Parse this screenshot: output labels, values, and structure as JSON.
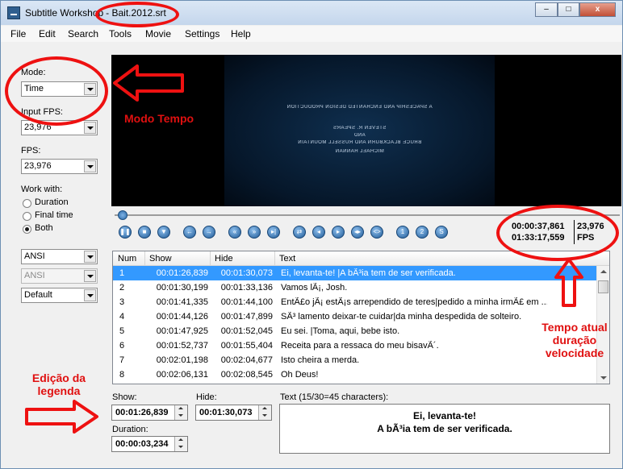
{
  "window": {
    "app_title": "Subtitle Workshop",
    "file_title": "- Bait.2012.srt",
    "minimize": "–",
    "maximize": "□",
    "close": "x"
  },
  "menu": [
    "File",
    "Edit",
    "Search",
    "Tools",
    "Movie",
    "Settings",
    "Help"
  ],
  "left_panel": {
    "mode_label": "Mode:",
    "mode_value": "Time",
    "input_fps_label": "Input FPS:",
    "input_fps_value": "23,976",
    "fps_label": "FPS:",
    "fps_value": "23,976",
    "work_with_label": "Work with:",
    "radios": [
      {
        "label": "Duration",
        "checked": false
      },
      {
        "label": "Final time",
        "checked": false
      },
      {
        "label": "Both",
        "checked": true
      }
    ],
    "charset1": "ANSI",
    "charset2": "ANSI",
    "format": "Default"
  },
  "video": {
    "credit_line1": "A SPACESHIP AND ENCHANTED DESIGN PRODUCTION",
    "credit_line2": "STEVEN R. SPEARS",
    "credit_line3": "AND",
    "credit_line4": "BRUCE BLACKBURN AND RUSSELL MOUNTAIN",
    "credit_line5": "MICHAEL HANNAN"
  },
  "time_display": {
    "current_time": "00:00:37,861",
    "total_time": "01:33:17,559",
    "fps_value": "23,976",
    "fps_unit": "FPS"
  },
  "grid": {
    "columns": [
      "Num",
      "Show",
      "Hide",
      "Text"
    ],
    "rows": [
      {
        "num": "1",
        "show": "00:01:26,839",
        "hide": "00:01:30,073",
        "text": "Ei, levanta-te! |A bÃ³ia tem de ser verificada.",
        "selected": true
      },
      {
        "num": "2",
        "show": "00:01:30,199",
        "hide": "00:01:33,136",
        "text": "Vamos lÃ¡, Josh.",
        "selected": false
      },
      {
        "num": "3",
        "show": "00:01:41,335",
        "show_": "",
        "hide": "00:01:44,100",
        "text": "EntÃ£o jÃ¡ estÃ¡s arrependido de teres|pedido a minha irmÃ£ em ...",
        "selected": false
      },
      {
        "num": "4",
        "show": "00:01:44,126",
        "hide": "00:01:47,899",
        "text": "SÃ³ lamento deixar-te cuidar|da minha despedida de solteiro.",
        "selected": false
      },
      {
        "num": "5",
        "show": "00:01:47,925",
        "hide": "00:01:52,045",
        "text": "Eu sei. |Toma, aqui, bebe isto.",
        "selected": false
      },
      {
        "num": "6",
        "show": "00:01:52,737",
        "hide": "00:01:55,404",
        "text": "Receita para a ressaca do meu bisavÃ´.",
        "selected": false
      },
      {
        "num": "7",
        "show": "00:02:01,198",
        "hide": "00:02:04,677",
        "text": "Isto cheira a merda.",
        "selected": false
      },
      {
        "num": "8",
        "show": "00:02:06,131",
        "hide": "00:02:08,545",
        "text": "Oh Deus!",
        "selected": false
      }
    ]
  },
  "edit": {
    "show_label": "Show:",
    "show_value": "00:01:26,839",
    "hide_label": "Hide:",
    "hide_value": "00:01:30,073",
    "duration_label": "Duration:",
    "duration_value": "00:00:03,234",
    "text_label": "Text (15/30=45 characters):",
    "text_line1": "Ei, levanta-te!",
    "text_line2": "A bÃ³ia tem de ser verificada."
  },
  "annotations": {
    "mode": "Modo Tempo",
    "time_line1": "Tempo atual",
    "time_line2": "duração",
    "time_line3": "velocidade",
    "edit_line1": "Edição da",
    "edit_line2": "legenda",
    "color": "#e01010"
  }
}
